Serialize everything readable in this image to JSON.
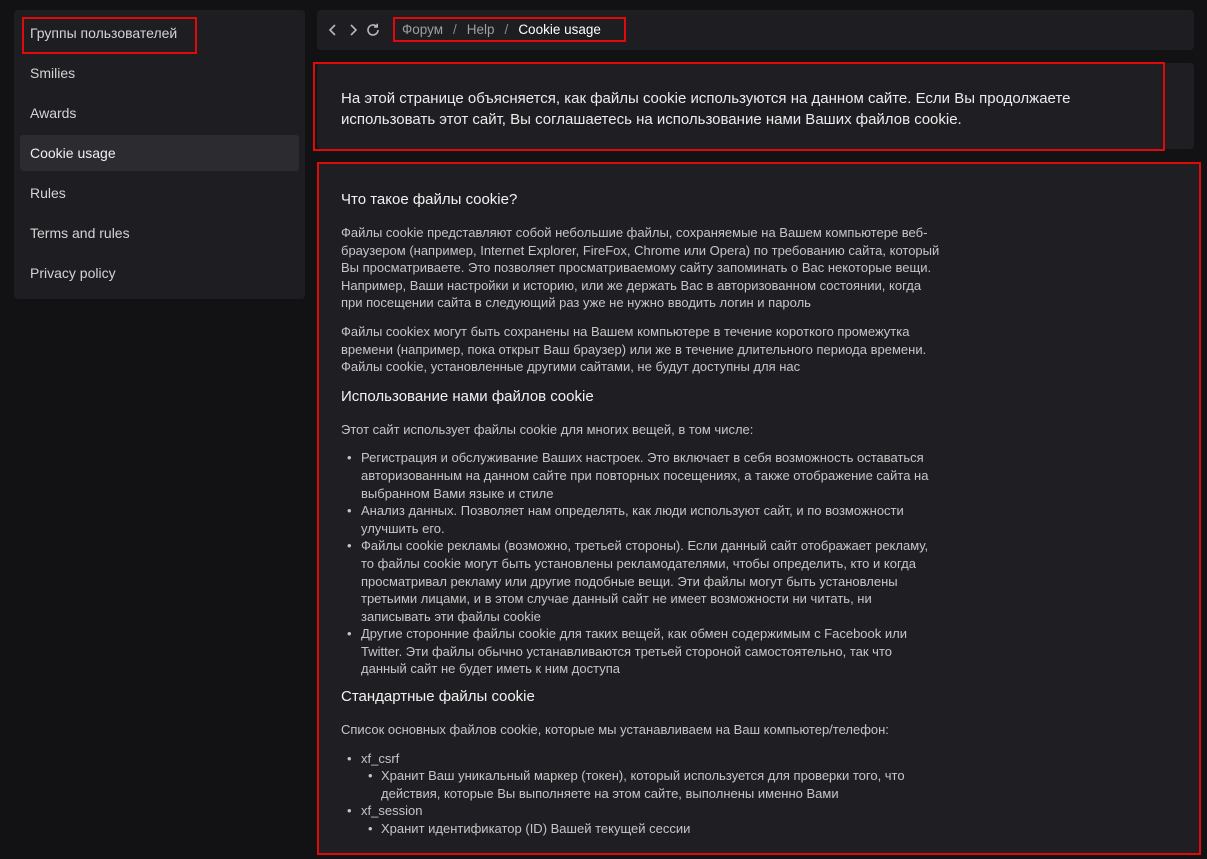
{
  "sidebar": {
    "items": [
      {
        "label": "Группы пользователей"
      },
      {
        "label": "Smilies"
      },
      {
        "label": "Awards"
      },
      {
        "label": "Cookie usage"
      },
      {
        "label": "Rules"
      },
      {
        "label": "Terms and rules"
      },
      {
        "label": "Privacy policy"
      }
    ],
    "active_index": 3
  },
  "nav": {
    "back_icon": "chevron-left-icon",
    "forward_icon": "chevron-right-icon",
    "reload_icon": "reload-icon",
    "breadcrumb": {
      "items": [
        "Форум",
        "Help"
      ],
      "separator": "/",
      "current": "Cookie usage"
    }
  },
  "intro": {
    "text": "На этой странице объясняется, как файлы cookie используются на данном сайте. Если Вы продолжаете использовать этот сайт, Вы соглашаетесь на использование нами Ваших файлов cookie."
  },
  "content": {
    "section1": {
      "heading": "Что такое файлы cookie?",
      "p1": "Файлы cookie представляют собой небольшие файлы, сохраняемые на Вашем компьютере веб-браузером (например, Internet Explorer, FireFox, Chrome или Opera) по требованию сайта, который Вы просматриваете. Это позволяет просматриваемому сайту запоминать о Вас некоторые вещи. Например, Ваши настройки и историю, или же держать Вас в авторизованном состоянии, когда при посещении сайта в следующий раз уже не нужно вводить логин и пароль",
      "p2": "Файлы cookiex могут быть сохранены на Вашем компьютере в течение короткого промежутка времени (например, пока открыт Ваш браузер) или же в течение длительного периода времени. Файлы cookie, установленные другими сайтами, не будут доступны для нас"
    },
    "section2": {
      "heading": "Использование нами файлов cookie",
      "intro": "Этот сайт использует файлы cookie для многих вещей, в том числе:",
      "items": [
        "Регистрация и обслуживание Ваших настроек. Это включает в себя возможность оставаться авторизованным на данном сайте при повторных посещениях, а также отображение сайта на выбранном Вами языке и стиле",
        "Анализ данных. Позволяет нам определять, как люди используют сайт, и по возможности улучшить его.",
        "Файлы cookie рекламы (возможно, третьей стороны). Если данный сайт отображает рекламу, то файлы cookie могут быть установлены рекламодателями, чтобы определить, кто и когда просматривал рекламу или другие подобные вещи. Эти файлы могут быть установлены третьими лицами, и в этом случае данный сайт не имеет возможности ни читать, ни записывать эти файлы cookie",
        "Другие сторонние файлы cookie для таких вещей, как обмен содержимым с Facebook или Twitter. Эти файлы обычно устанавливаются третьей стороной самостоятельно, так что данный сайт не будет иметь к ним доступа"
      ]
    },
    "section3": {
      "heading": "Стандартные файлы cookie",
      "intro": "Список основных файлов cookie, которые мы устанавливаем на Ваш компьютер/телефон:",
      "cookies": [
        {
          "name": "xf_csrf",
          "desc": "Хранит Ваш уникальный маркер (токен), который используется для проверки того, что действия, которые Вы выполняете на этом сайте, выполнены именно Вами"
        },
        {
          "name": "xf_session",
          "desc": "Хранит идентификатор (ID) Вашей текущей сессии"
        }
      ]
    }
  },
  "colors": {
    "background": "#121214",
    "panel": "#1e1e22",
    "highlight_border": "#e10a0a"
  }
}
